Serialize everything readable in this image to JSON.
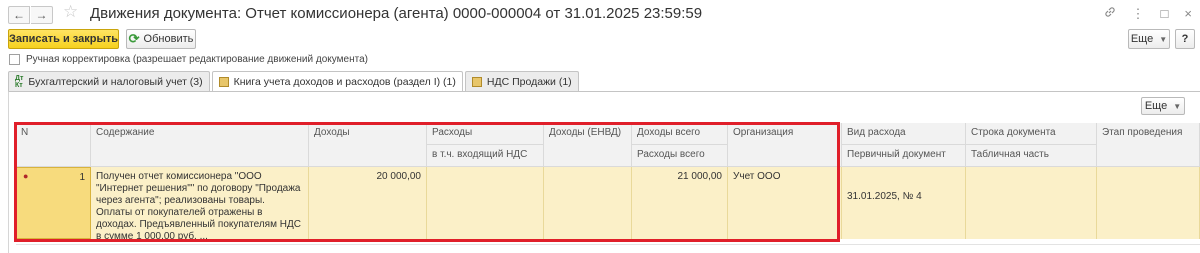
{
  "titlebar": {
    "back": "←",
    "forward": "→",
    "star": "☆",
    "title": "Движения документа: Отчет комиссионера (агента) 0000-000004 от 31.01.2025 23:59:59",
    "link_icon": "🔗",
    "menu_icon": "⋮",
    "restore_icon": "□",
    "close_icon": "×"
  },
  "toolbar": {
    "save_close": "Записать и закрыть",
    "refresh": "Обновить",
    "more": "Еще",
    "help": "?"
  },
  "manual": {
    "label": "Ручная корректировка (разрешает редактирование движений документа)"
  },
  "tabs": [
    {
      "label": "Бухгалтерский и налоговый учет (3)"
    },
    {
      "label": "Книга учета доходов и расходов (раздел I) (1)"
    },
    {
      "label": "НДС Продажи (1)"
    }
  ],
  "grid_toolbar": {
    "more": "Еще"
  },
  "columns": {
    "n": "N",
    "content": "Содержание",
    "income": "Доходы",
    "expenses": "Расходы",
    "expenses_vat": "в т.ч. входящий НДС",
    "income_envd": "Доходы (ЕНВД)",
    "income_total": "Доходы всего",
    "expenses_total": "Расходы всего",
    "organization": "Организация",
    "expense_type": "Вид расхода",
    "primary_doc": "Первичный документ",
    "doc_line": "Строка документа",
    "table_part": "Табличная часть",
    "stage": "Этап проведения"
  },
  "rows": [
    {
      "n": "1",
      "content": "Получен отчет комиссионера \"ООО \"Интернет решения\"\" по договору \"Продажа через агента\"; реализованы товары. Оплаты от покупателей отражены в доходах. Предъявленный покупателям НДС в сумме 1 000,00 руб. ...",
      "income": "20 000,00",
      "expenses": "",
      "expenses_vat": "",
      "income_envd": "",
      "income_total": "21 000,00",
      "expenses_total": "",
      "organization": "Учет ООО",
      "expense_type": "",
      "primary_doc": "31.01.2025, № 4",
      "doc_line": "",
      "table_part": "",
      "stage": ""
    }
  ],
  "colors": {
    "accent": "#f6d11e",
    "row": "#fbf0c8",
    "highlight_frame": "#e01f2a"
  }
}
